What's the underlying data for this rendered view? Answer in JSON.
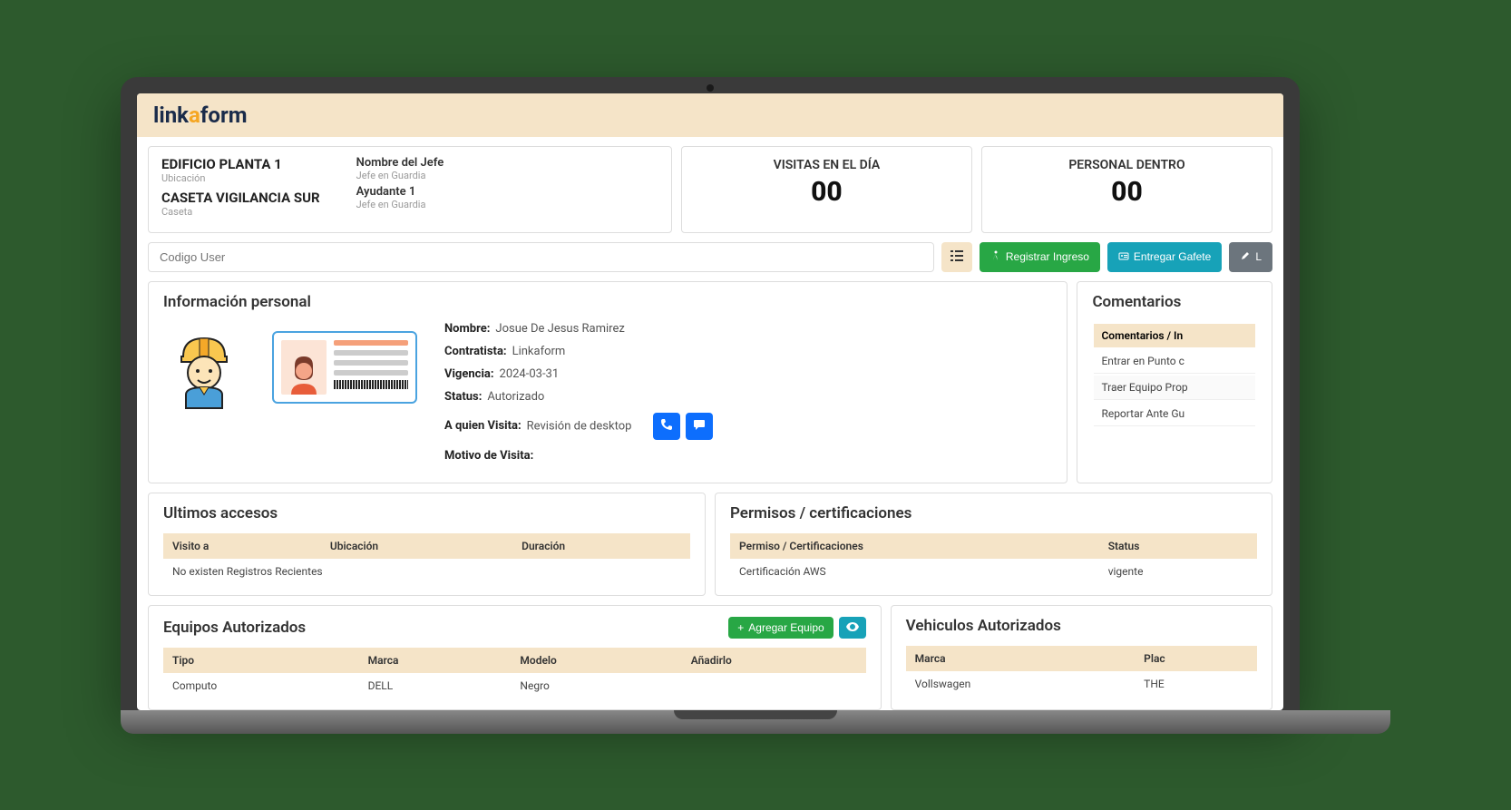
{
  "logo": {
    "part1": "link",
    "part2": "a",
    "part3": "form"
  },
  "header": {
    "building": "EDIFICIO PLANTA 1",
    "building_sub": "Ubicación",
    "booth": "CASETA VIGILANCIA SUR",
    "booth_sub": "Caseta",
    "boss_label": "Nombre del Jefe",
    "boss_sub": "Jefe en Guardia",
    "assistant_label": "Ayudante 1",
    "assistant_sub": "Jefe en Guardia"
  },
  "stats": {
    "visits_label": "VISITAS EN EL DÍA",
    "visits_value": "00",
    "personnel_label": "PERSONAL DENTRO",
    "personnel_value": "00"
  },
  "search": {
    "placeholder": "Codigo User"
  },
  "buttons": {
    "list_icon": "≡",
    "register": "Registrar Ingreso",
    "badge": "Entregar Gafete",
    "third": "L"
  },
  "personal": {
    "title": "Información personal",
    "name_label": "Nombre:",
    "name": "Josue De Jesus Ramirez",
    "contractor_label": "Contratista:",
    "contractor": "Linkaform",
    "validity_label": "Vigencia:",
    "validity": "2024-03-31",
    "status_label": "Status:",
    "status": "Autorizado",
    "visits_label": "A quien Visita:",
    "visits": "Revisión de desktop",
    "reason_label": "Motivo de Visita:",
    "reason": ""
  },
  "comments": {
    "title": "Comentarios",
    "header": "Comentarios / In",
    "rows": [
      "Entrar en Punto c",
      "Traer Equipo Prop",
      "Reportar Ante Gu"
    ]
  },
  "access": {
    "title": "Ultimos accesos",
    "cols": [
      "Visito a",
      "Ubicación",
      "Duración"
    ],
    "empty": "No existen Registros Recientes"
  },
  "permits": {
    "title": "Permisos / certificaciones",
    "cols": [
      "Permiso / Certificaciones",
      "Status"
    ],
    "rows": [
      [
        "Certificación AWS",
        "vigente"
      ]
    ]
  },
  "equipment": {
    "title": "Equipos Autorizados",
    "add_btn": "Agregar Equipo",
    "cols": [
      "Tipo",
      "Marca",
      "Modelo",
      "Añadirlo"
    ],
    "rows": [
      [
        "Computo",
        "DELL",
        "Negro",
        ""
      ]
    ]
  },
  "vehicles": {
    "title": "Vehiculos Autorizados",
    "cols": [
      "Marca",
      "Plac"
    ],
    "rows": [
      [
        "Vollswagen",
        "THE"
      ]
    ]
  }
}
